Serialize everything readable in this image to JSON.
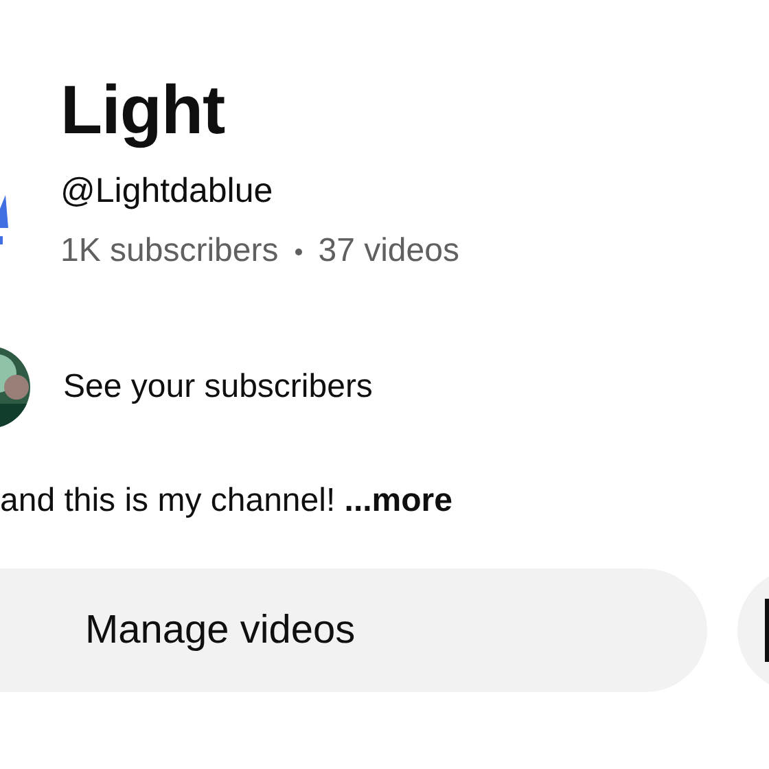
{
  "channel": {
    "name": "Light",
    "handle": "@Lightdablue",
    "stats": [
      "1K subscribers",
      "37 videos"
    ]
  },
  "subscribers_link": {
    "label": "See your subscribers"
  },
  "description": {
    "text": "and this is my channel!",
    "more": "...more"
  },
  "buttons": [
    {
      "label": "Manage videos"
    },
    {
      "kind": "icon"
    }
  ]
}
